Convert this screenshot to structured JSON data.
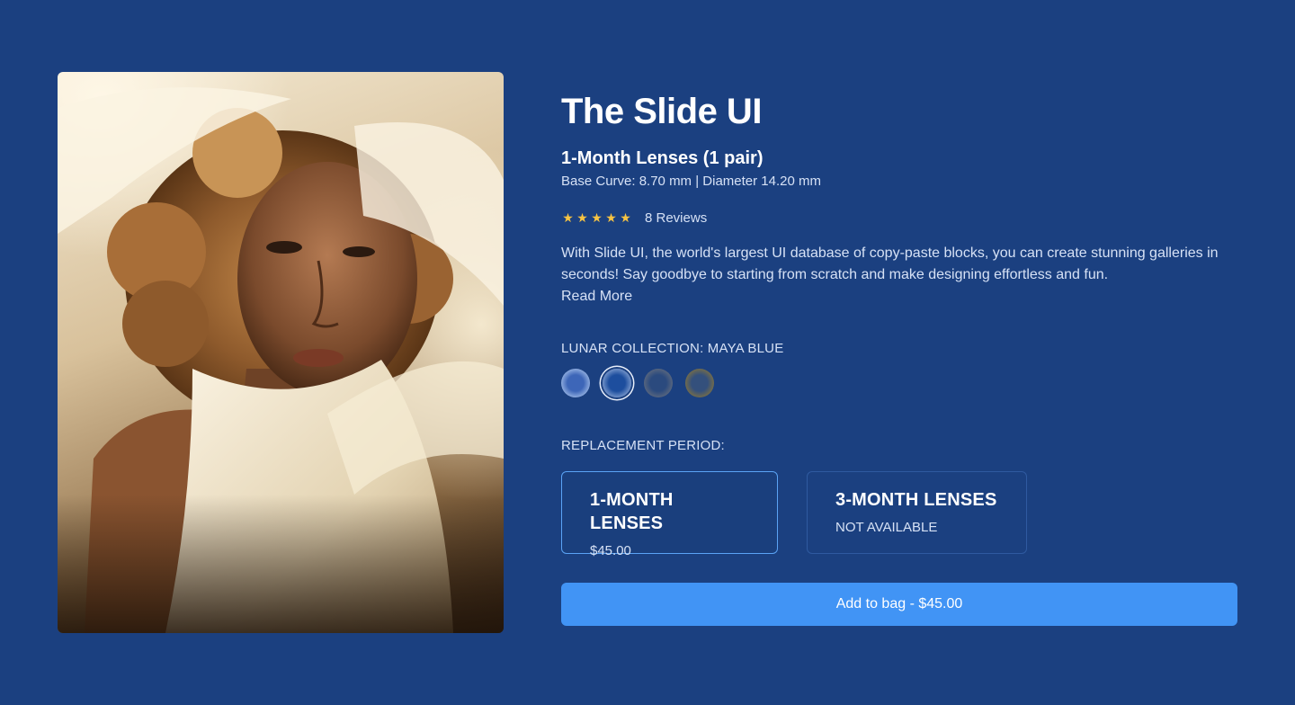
{
  "product": {
    "image_alt": "Woman in white flowing fabric",
    "title": "The Slide UI",
    "subtitle": "1-Month Lenses (1 pair)",
    "specs": "Base Curve: 8.70 mm | Diameter 14.20 mm",
    "rating": {
      "stars": 5,
      "star_glyph": "★",
      "reviews_label": "8 Reviews"
    },
    "description": "With Slide UI, the world's largest UI database of copy-paste blocks, you can create stunning galleries in seconds! Say goodbye to starting from scratch and make designing effortless and fun.",
    "read_more": "Read More"
  },
  "collection": {
    "label": "LUNAR COLLECTION: MAYA BLUE",
    "swatches": [
      {
        "name": "light-blue",
        "inner": "#3d66b8",
        "outer": "#8aa8dc",
        "selected": false
      },
      {
        "name": "maya-blue",
        "inner": "#1d4e9e",
        "outer": "#6e8fc6",
        "selected": true
      },
      {
        "name": "grey",
        "inner": "#2b4a7e",
        "outer": "#55647e",
        "selected": false
      },
      {
        "name": "hazel",
        "inner": "#34507c",
        "outer": "#6f6a4e",
        "selected": false
      }
    ]
  },
  "replacement": {
    "label": "REPLACEMENT PERIOD:",
    "options": [
      {
        "name": "1-MONTH LENSES",
        "price": "$45.00",
        "active": true
      },
      {
        "name": "3-MONTH LENSES",
        "price": "NOT AVAILABLE",
        "active": false
      }
    ]
  },
  "cart": {
    "button_label": "Add to bag - $45.00"
  },
  "colors": {
    "background": "#1b4080",
    "accent": "#4194f5",
    "star": "#f6c343"
  }
}
